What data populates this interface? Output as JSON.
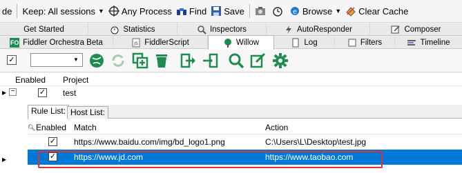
{
  "toolbar": {
    "partial_label": "de",
    "keep_sessions": "Keep: All sessions",
    "any_process": "Any Process",
    "find": "Find",
    "save": "Save",
    "browse": "Browse",
    "clear_cache": "Clear Cache"
  },
  "tabs_row1": [
    "Get Started",
    "Statistics",
    "Inspectors",
    "AutoResponder",
    "Composer"
  ],
  "tabs_row2": [
    "Fiddler Orchestra Beta",
    "FiddlerScript",
    "Willow",
    "Log",
    "Filters",
    "Timeline"
  ],
  "fo_badge": "FO",
  "grid": {
    "col_enabled": "Enabled",
    "col_project": "Project",
    "project_name": "test",
    "project_enabled": true
  },
  "inner_tabs": [
    "Rule List:",
    "Host List:"
  ],
  "rules": {
    "col_enabled": "Enabled",
    "col_match": "Match",
    "col_action": "Action",
    "rows": [
      {
        "enabled": true,
        "match": "https://www.baidu.com/img/bd_logo1.png",
        "action": "C:\\Users\\L\\Desktop\\test.jpg",
        "selected": false
      },
      {
        "enabled": true,
        "match": "https://www.jd.com",
        "action": "https://www.taobao.com",
        "selected": true
      }
    ]
  },
  "colors": {
    "selection": "#0078d7",
    "highlight_box": "#e03131",
    "willow_icons": "#1e8c4e"
  }
}
